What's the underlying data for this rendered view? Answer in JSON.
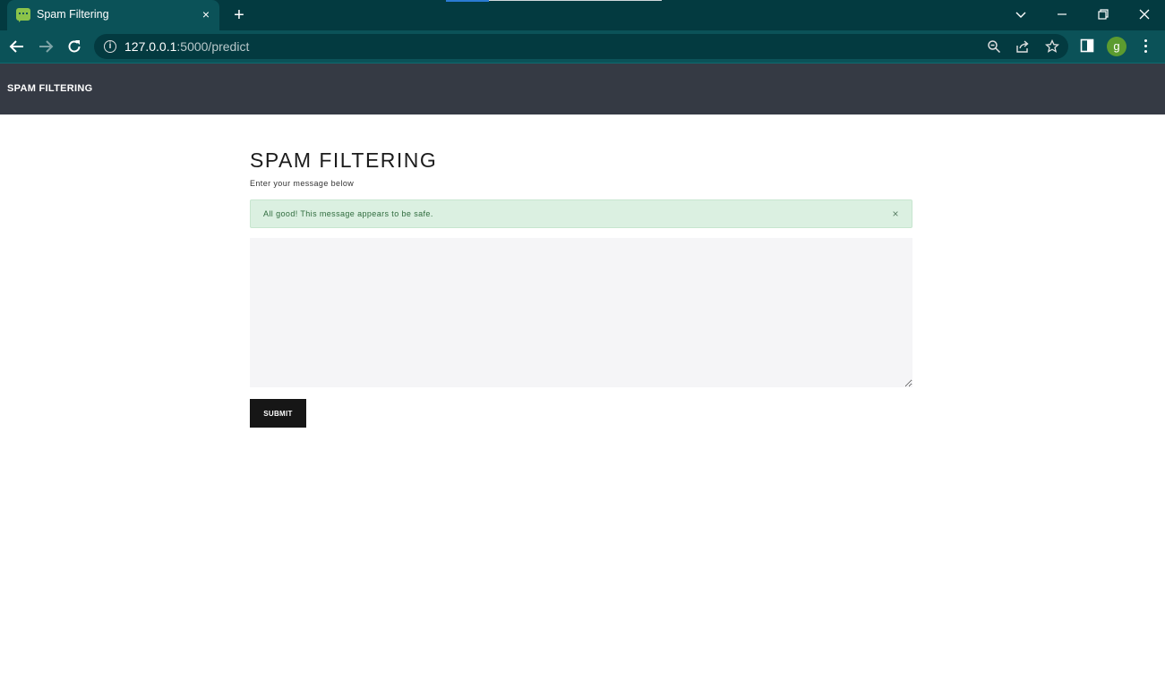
{
  "browser": {
    "tab": {
      "title": "Spam Filtering",
      "close_glyph": "×"
    },
    "new_tab_glyph": "+",
    "address": {
      "host": "127.0.0.1",
      "rest": ":5000/predict"
    },
    "profile_initial": "g"
  },
  "navbar": {
    "brand": "SPAM FILTERING"
  },
  "main": {
    "title": "SPAM FILTERING",
    "subtitle": "Enter your message below",
    "alert": {
      "text": "All good! This message appears to be safe.",
      "close_glyph": "×",
      "color": "#dbf0e1"
    },
    "textarea": {
      "value": "",
      "placeholder": ""
    },
    "submit_label": "SUBMIT"
  },
  "colors": {
    "titlebar": "#033a40",
    "toolbar": "#0b5258",
    "navbar": "#353a44",
    "submit": "#161616"
  }
}
